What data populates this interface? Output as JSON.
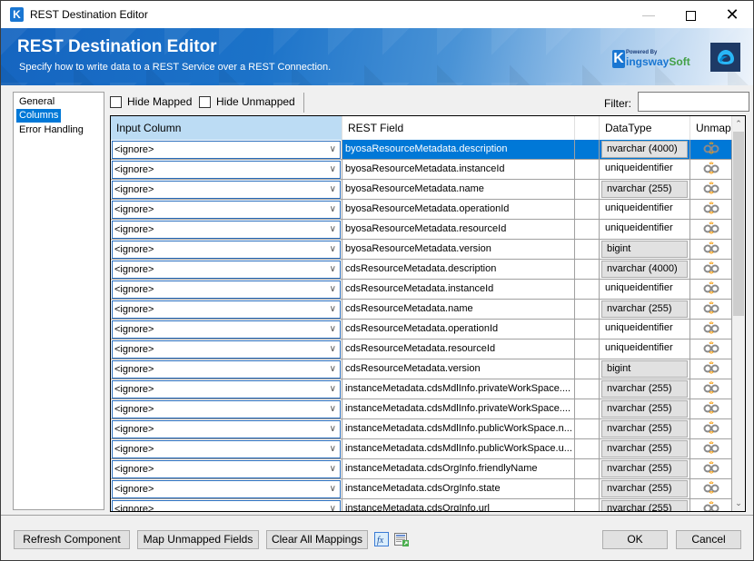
{
  "window": {
    "title": "REST Destination Editor",
    "app_icon_letter": "K",
    "controls": {
      "minimize": "—",
      "maximize": "",
      "close": "✕"
    }
  },
  "banner": {
    "title": "REST Destination Editor",
    "subtitle": "Specify how to write data to a REST Service over a REST Connection.",
    "brand": {
      "powered_by": "Powered By",
      "letter": "K",
      "name_part1": "ingsway",
      "name_part2": "Soft"
    }
  },
  "nav": {
    "items": [
      {
        "label": "General",
        "selected": false
      },
      {
        "label": "Columns",
        "selected": true
      },
      {
        "label": "Error Handling",
        "selected": false
      }
    ]
  },
  "toolbar": {
    "hide_mapped": {
      "label": "Hide Mapped",
      "checked": false
    },
    "hide_unmapped": {
      "label": "Hide Unmapped",
      "checked": false
    },
    "filter_label": "Filter:",
    "filter_value": ""
  },
  "grid": {
    "headers": {
      "input": "Input Column",
      "field": "REST Field",
      "blank": "",
      "type": "DataType",
      "unmap": "Unmap"
    },
    "rows": [
      {
        "input": "<ignore>",
        "field": "byosaResourceMetadata.description",
        "type": "nvarchar (4000)",
        "boxed": true,
        "selected": true
      },
      {
        "input": "<ignore>",
        "field": "byosaResourceMetadata.instanceId",
        "type": "uniqueidentifier",
        "boxed": false
      },
      {
        "input": "<ignore>",
        "field": "byosaResourceMetadata.name",
        "type": "nvarchar (255)",
        "boxed": true
      },
      {
        "input": "<ignore>",
        "field": "byosaResourceMetadata.operationId",
        "type": "uniqueidentifier",
        "boxed": false
      },
      {
        "input": "<ignore>",
        "field": "byosaResourceMetadata.resourceId",
        "type": "uniqueidentifier",
        "boxed": false
      },
      {
        "input": "<ignore>",
        "field": "byosaResourceMetadata.version",
        "type": "bigint",
        "boxed": true
      },
      {
        "input": "<ignore>",
        "field": "cdsResourceMetadata.description",
        "type": "nvarchar (4000)",
        "boxed": true
      },
      {
        "input": "<ignore>",
        "field": "cdsResourceMetadata.instanceId",
        "type": "uniqueidentifier",
        "boxed": false
      },
      {
        "input": "<ignore>",
        "field": "cdsResourceMetadata.name",
        "type": "nvarchar (255)",
        "boxed": true
      },
      {
        "input": "<ignore>",
        "field": "cdsResourceMetadata.operationId",
        "type": "uniqueidentifier",
        "boxed": false
      },
      {
        "input": "<ignore>",
        "field": "cdsResourceMetadata.resourceId",
        "type": "uniqueidentifier",
        "boxed": false
      },
      {
        "input": "<ignore>",
        "field": "cdsResourceMetadata.version",
        "type": "bigint",
        "boxed": true
      },
      {
        "input": "<ignore>",
        "field": "instanceMetadata.cdsMdlInfo.privateWorkSpace....",
        "type": "nvarchar (255)",
        "boxed": true
      },
      {
        "input": "<ignore>",
        "field": "instanceMetadata.cdsMdlInfo.privateWorkSpace....",
        "type": "nvarchar (255)",
        "boxed": true
      },
      {
        "input": "<ignore>",
        "field": "instanceMetadata.cdsMdlInfo.publicWorkSpace.n...",
        "type": "nvarchar (255)",
        "boxed": true
      },
      {
        "input": "<ignore>",
        "field": "instanceMetadata.cdsMdlInfo.publicWorkSpace.u...",
        "type": "nvarchar (255)",
        "boxed": true
      },
      {
        "input": "<ignore>",
        "field": "instanceMetadata.cdsOrgInfo.friendlyName",
        "type": "nvarchar (255)",
        "boxed": true
      },
      {
        "input": "<ignore>",
        "field": "instanceMetadata.cdsOrgInfo.state",
        "type": "nvarchar (255)",
        "boxed": true
      },
      {
        "input": "<ignore>",
        "field": "instanceMetadata.cdsOrgInfo.url",
        "type": "nvarchar (255)",
        "boxed": true
      }
    ],
    "scroll": {
      "up": "⌃",
      "down": "⌄"
    }
  },
  "buttons": {
    "refresh": "Refresh Component",
    "map_unmapped": "Map Unmapped Fields",
    "clear_all": "Clear All Mappings",
    "ok": "OK",
    "cancel": "Cancel"
  },
  "colors": {
    "accent": "#0078d7",
    "banner_blue": "#1565c0",
    "header_highlight": "#bcdcf4",
    "brand_green": "#43a047"
  }
}
